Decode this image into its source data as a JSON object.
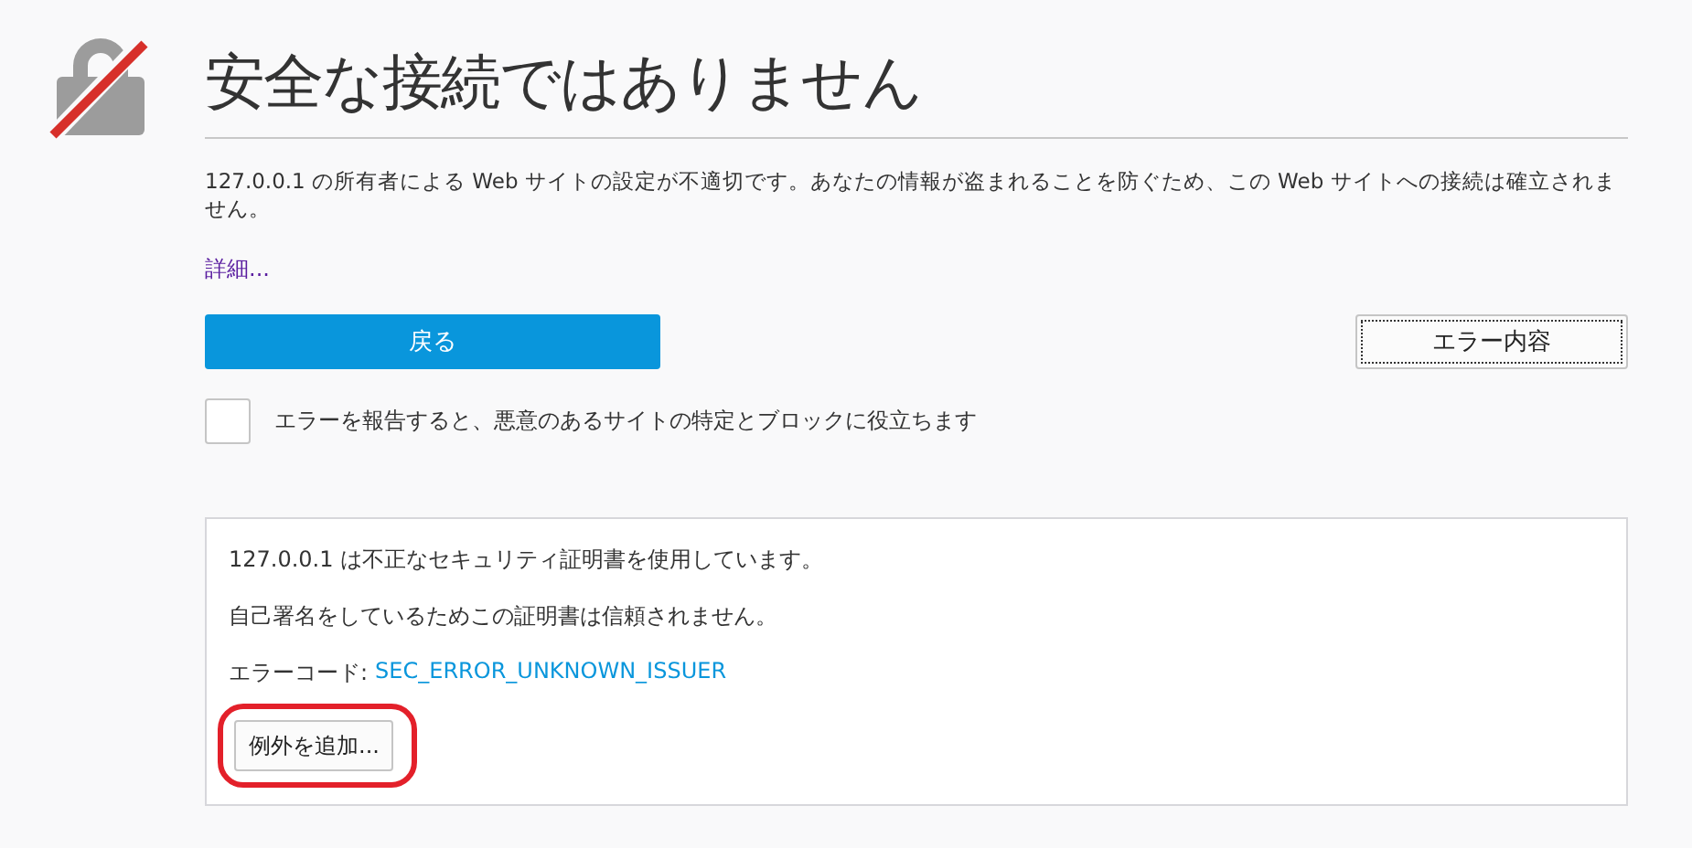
{
  "title": "安全な接続ではありません",
  "description": "127.0.0.1 の所有者による Web サイトの設定が不適切です。あなたの情報が盗まれることを防ぐため、この Web サイトへの接続は確立されません。",
  "details_link": "詳細...",
  "back_button": "戻る",
  "error_details_button": "エラー内容",
  "report_checkbox": {
    "label": "エラーを報告すると、悪意のあるサイトの特定とブロックに役立ちます",
    "checked": false
  },
  "details_panel": {
    "lines": [
      "127.0.0.1 は不正なセキュリティ証明書を使用しています。",
      "自己署名をしているためこの証明書は信頼されません。"
    ],
    "error_code_label": "エラーコード:",
    "error_code": "SEC_ERROR_UNKNOWN_ISSUER",
    "add_exception_button": {
      "label": "例外を追加...",
      "highlighted": true
    }
  }
}
